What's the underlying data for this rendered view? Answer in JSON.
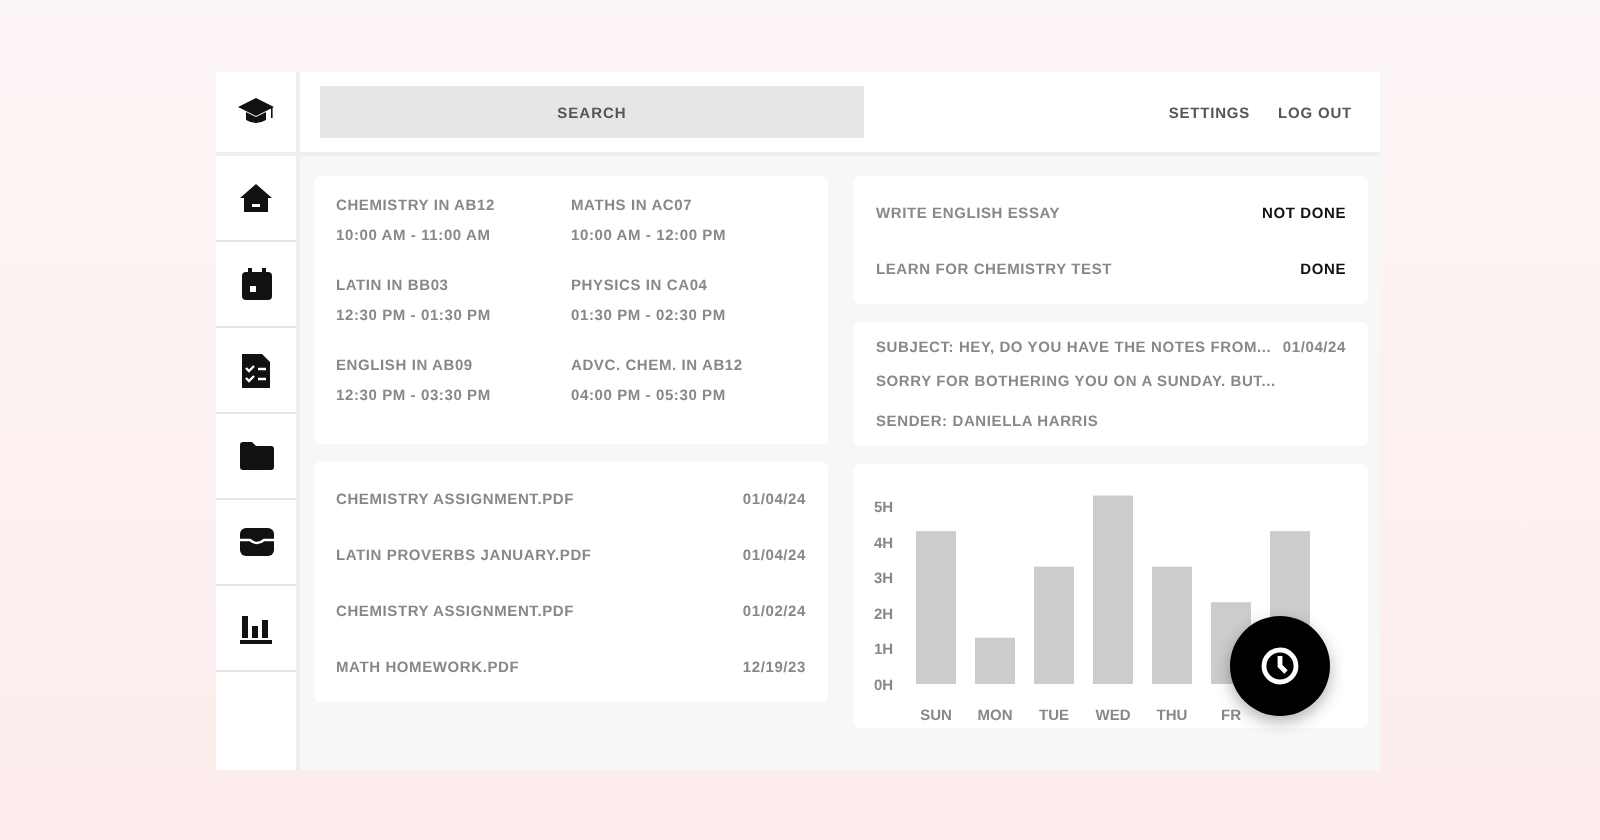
{
  "search": {
    "placeholder": "SEARCH"
  },
  "nav": [
    "SETTINGS",
    "LOG OUT"
  ],
  "schedule": [
    {
      "course": "CHEMISTRY IN AB12",
      "time": "10:00 AM - 11:00 AM"
    },
    {
      "course": "MATHS IN AC07",
      "time": "10:00 AM - 12:00 PM"
    },
    {
      "course": "LATIN IN BB03",
      "time": "12:30 PM - 01:30 PM"
    },
    {
      "course": "PHYSICS IN CA04",
      "time": "01:30 PM - 02:30 PM"
    },
    {
      "course": "ENGLISH IN AB09",
      "time": "12:30 PM - 03:30 PM"
    },
    {
      "course": "ADVC. CHEM. IN AB12",
      "time": "04:00 PM - 05:30 PM"
    }
  ],
  "files": [
    {
      "name": "CHEMISTRY ASSIGNMENT.PDF",
      "date": "01/04/24"
    },
    {
      "name": "LATIN PROVERBS JANUARY.PDF",
      "date": "01/04/24"
    },
    {
      "name": "CHEMISTRY ASSIGNMENT.PDF",
      "date": "01/02/24"
    },
    {
      "name": "MATH HOMEWORK.PDF",
      "date": "12/19/23"
    }
  ],
  "tasks": [
    {
      "title": "WRITE ENGLISH ESSAY",
      "status": "NOT DONE"
    },
    {
      "title": "LEARN FOR CHEMISTRY TEST",
      "status": "DONE"
    }
  ],
  "message": {
    "subject": "SUBJECT: HEY, DO YOU HAVE THE NOTES FROM...",
    "date": "01/04/24",
    "preview": "SORRY FOR BOTHERING YOU ON A SUNDAY. BUT...",
    "sender": "SENDER: DANIELLA HARRIS"
  },
  "study_chart": {
    "chart_data": {
      "type": "bar",
      "categories": [
        "SUN",
        "MON",
        "TUE",
        "WED",
        "THU",
        "FR",
        null
      ],
      "series": [
        {
          "color": "#cccccc",
          "values": [
            4.3,
            1.3,
            3.3,
            5.3,
            3.3,
            2.3,
            4.3
          ]
        }
      ],
      "ylim": [
        0,
        5.4
      ],
      "yticks": [
        {
          "value": 0,
          "label": "0H"
        },
        {
          "value": 1,
          "label": "1H"
        },
        {
          "value": 2,
          "label": "2H"
        },
        {
          "value": 3,
          "label": "3H"
        },
        {
          "value": 4,
          "label": "4H"
        },
        {
          "value": 5,
          "label": "5H"
        }
      ]
    }
  }
}
